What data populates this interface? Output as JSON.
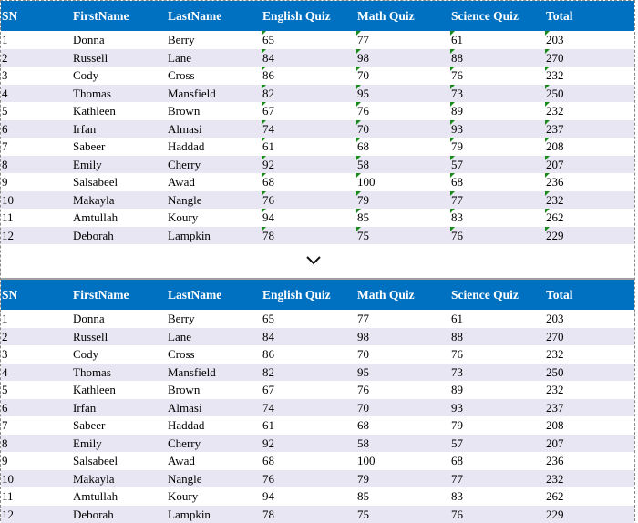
{
  "headers": [
    "SN",
    "FirstName",
    "LastName",
    "English Quiz",
    "Math Quiz",
    "Science Quiz",
    "Total"
  ],
  "rows": [
    [
      "1",
      "Donna",
      "Berry",
      "65",
      "77",
      "61",
      "203"
    ],
    [
      "2",
      "Russell",
      "Lane",
      "84",
      "98",
      "88",
      "270"
    ],
    [
      "3",
      "Cody",
      "Cross",
      "86",
      "70",
      "76",
      "232"
    ],
    [
      "4",
      "Thomas",
      "Mansfield",
      "82",
      "95",
      "73",
      "250"
    ],
    [
      "5",
      "Kathleen",
      "Brown",
      "67",
      "76",
      "89",
      "232"
    ],
    [
      "6",
      "Irfan",
      "Almasi",
      "74",
      "70",
      "93",
      "237"
    ],
    [
      "7",
      "Sabeer",
      "Haddad",
      "61",
      "68",
      "79",
      "208"
    ],
    [
      "8",
      "Emily",
      "Cherry",
      "92",
      "58",
      "57",
      "207"
    ],
    [
      "9",
      "Salsabeel",
      "Awad",
      "68",
      "100",
      "68",
      "236"
    ],
    [
      "10",
      "Makayla",
      "Nangle",
      "76",
      "79",
      "77",
      "232"
    ],
    [
      "11",
      "Amtullah",
      "Koury",
      "94",
      "85",
      "83",
      "262"
    ],
    [
      "12",
      "Deborah",
      "Lampkin",
      "78",
      "75",
      "76",
      "229"
    ]
  ],
  "colors": {
    "header_bg": "#0070c0",
    "alt_row": "#e8e6f2",
    "text_number_flag": "#1a8a1a"
  },
  "arrow_icon": "chevron-down-icon"
}
